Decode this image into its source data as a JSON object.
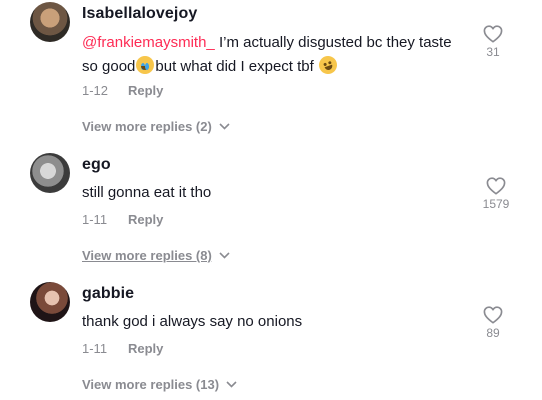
{
  "comments": [
    {
      "username": "Isabellalovejoy",
      "mention": "@frankiemaysmith_",
      "text_part1": " I’m actually disgusted bc they taste",
      "text_part2": "so good",
      "text_part3": "but what did I expect tbf ",
      "date": "1-12",
      "reply_label": "Reply",
      "likes": "31",
      "view_more": "View more replies (2)"
    },
    {
      "username": "ego",
      "text": "still gonna eat it tho",
      "date": "1-11",
      "reply_label": "Reply",
      "likes": "1579",
      "view_more": "View more replies (8)"
    },
    {
      "username": "gabbie",
      "text": "thank god i always say no onions",
      "date": "1-11",
      "reply_label": "Reply",
      "likes": "89",
      "view_more": "View more replies (13)"
    }
  ],
  "icons": {
    "like": "heart-outline-icon",
    "expand": "chevron-down-icon",
    "emoji1": "crying-laughing-emoji",
    "emoji2": "rofl-emoji"
  },
  "colors": {
    "mention": "#fe2c55",
    "secondary_text": "#8a8b91",
    "primary_text": "#161823"
  }
}
